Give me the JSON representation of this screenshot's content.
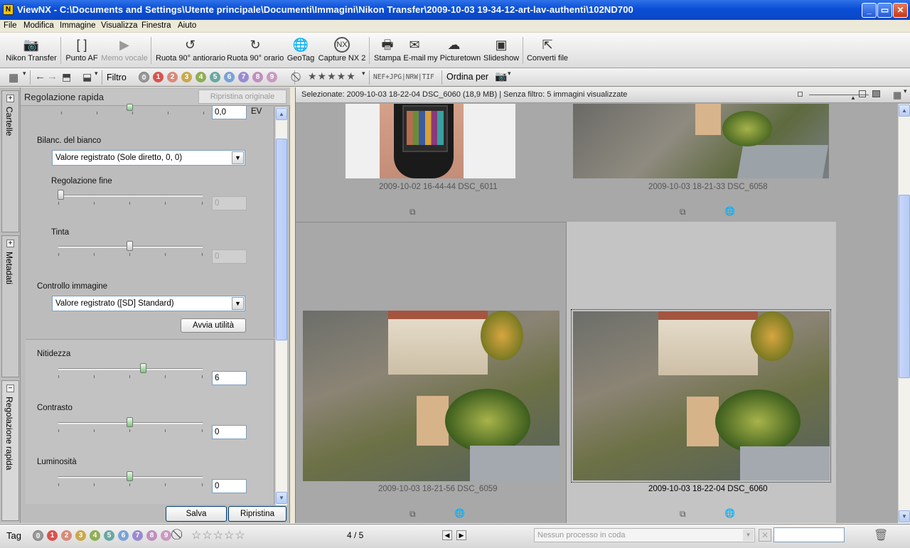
{
  "window": {
    "title": "ViewNX - C:\\Documents and Settings\\Utente principale\\Documenti\\Immagini\\Nikon Transfer\\2009-10-03 19-34-12-art-lav-authenti\\102ND700"
  },
  "menu": [
    "File",
    "Modifica",
    "Immagine",
    "Visualizza",
    "Finestra",
    "Aiuto"
  ],
  "toolbar": {
    "nikon_transfer": "Nikon Transfer",
    "punto_af": "Punto AF",
    "memo_vocale": "Memo vocale",
    "ruota_anti": "Ruota 90° antiorario",
    "ruota_orario": "Ruota 90° orario",
    "geotag": "GeoTag",
    "capture_nx": "Capture NX 2",
    "stampa": "Stampa",
    "email": "E-mail",
    "picturetown": "my Picturetown",
    "slideshow": "Slideshow",
    "converti": "Converti file"
  },
  "filterbar": {
    "filtro": "Filtro",
    "labels": [
      "0",
      "1",
      "2",
      "3",
      "4",
      "5",
      "6",
      "7",
      "8",
      "9"
    ],
    "label_colors": [
      "#9a9a9a",
      "#d9534f",
      "#d98a7a",
      "#c9a94b",
      "#8fae55",
      "#6aa8a2",
      "#7aa2d6",
      "#9a8bd0",
      "#c08fbf",
      "#c89ac0"
    ],
    "file_types": "NEF+JPG|NRW|TIF",
    "ordina": "Ordina per"
  },
  "left_tabs": {
    "cartelle": "Cartelle",
    "metadati": "Metadati",
    "regolazione": "Regolazione rapida"
  },
  "panel": {
    "title": "Regolazione rapida",
    "reset_original": "Ripristina originale",
    "exposure_value": "0,0",
    "exposure_unit": "EV",
    "wb_label": "Bilanc. del bianco",
    "wb_value": "Valore registrato (Sole diretto, 0, 0)",
    "fine_label": "Regolazione fine",
    "fine_value": "0",
    "tinta_label": "Tinta",
    "tinta_value": "0",
    "picture_control_label": "Controllo immagine",
    "picture_control_value": "Valore registrato ([SD] Standard)",
    "launch_button": "Avvia utilità",
    "sharpness_label": "Nitidezza",
    "sharpness_value": "6",
    "contrast_label": "Contrasto",
    "contrast_value": "0",
    "brightness_label": "Luminosità",
    "brightness_value": "0",
    "save_button": "Salva",
    "reset_button": "Ripristina"
  },
  "main": {
    "status": "Selezionate: 2009-10-03 18-22-04 DSC_6060 (18,9 MB) | Senza filtro: 5 immagini visualizzate",
    "thumbs": [
      {
        "caption": "2009-10-02 16-44-44 DSC_6011"
      },
      {
        "caption": "2009-10-03 18-21-33 DSC_6058"
      },
      {
        "caption": "2009-10-03 18-21-56 DSC_6059"
      },
      {
        "caption": "2009-10-03 18-22-04 DSC_6060"
      }
    ]
  },
  "statusbar": {
    "tag": "Tag",
    "labels": [
      "0",
      "1",
      "2",
      "3",
      "4",
      "5",
      "6",
      "7",
      "8",
      "9"
    ],
    "page": "4 / 5",
    "queue": "Nessun processo in coda"
  }
}
